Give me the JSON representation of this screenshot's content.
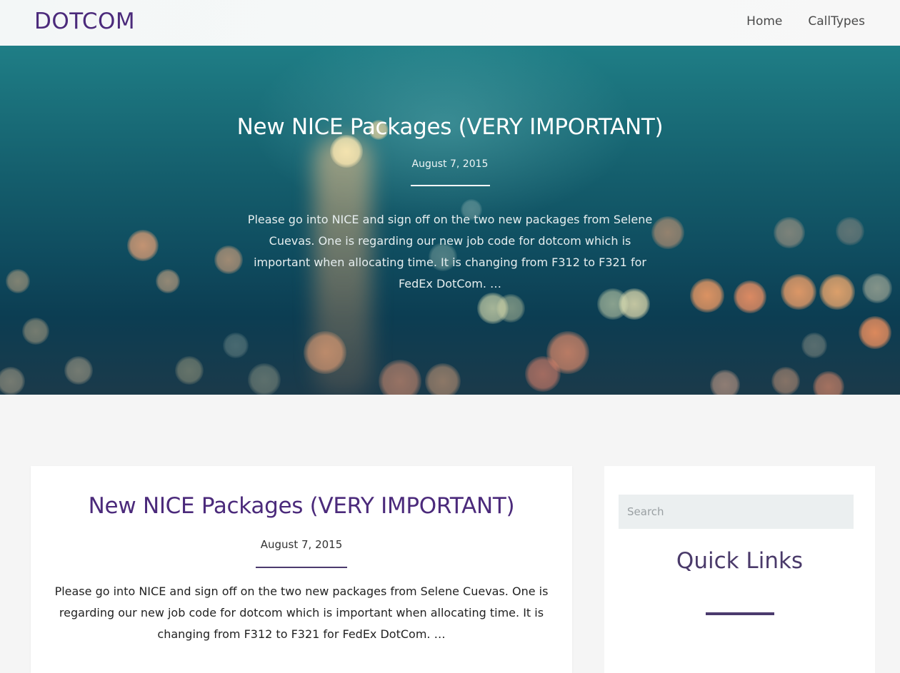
{
  "site": {
    "brand": "DOTCOM",
    "nav": [
      {
        "label": "Home"
      },
      {
        "label": "CallTypes"
      }
    ]
  },
  "hero": {
    "title": "New NICE Packages (VERY IMPORTANT)",
    "date": "August 7, 2015",
    "excerpt": "Please go into NICE and sign off on the two new packages from Selene Cuevas. One is regarding our new job code for dotcom which is important when allocating time. It is changing from F312 to F321 for FedEx DotCom. …"
  },
  "post": {
    "title": "New NICE Packages (VERY IMPORTANT)",
    "date": "August 7, 2015",
    "excerpt": "Please go into NICE and sign off on the two new packages from Selene Cuevas. One is regarding our new job code for dotcom which is important when allocating time. It is changing from F312 to F321 for FedEx DotCom. …"
  },
  "sidebar": {
    "search": {
      "placeholder": "Search",
      "value": ""
    },
    "widget_title": "Quick Links"
  },
  "colors": {
    "brand": "#4b2a7b",
    "accent_rule": "#4b3a6e",
    "page_background": "#f5f5f5"
  }
}
